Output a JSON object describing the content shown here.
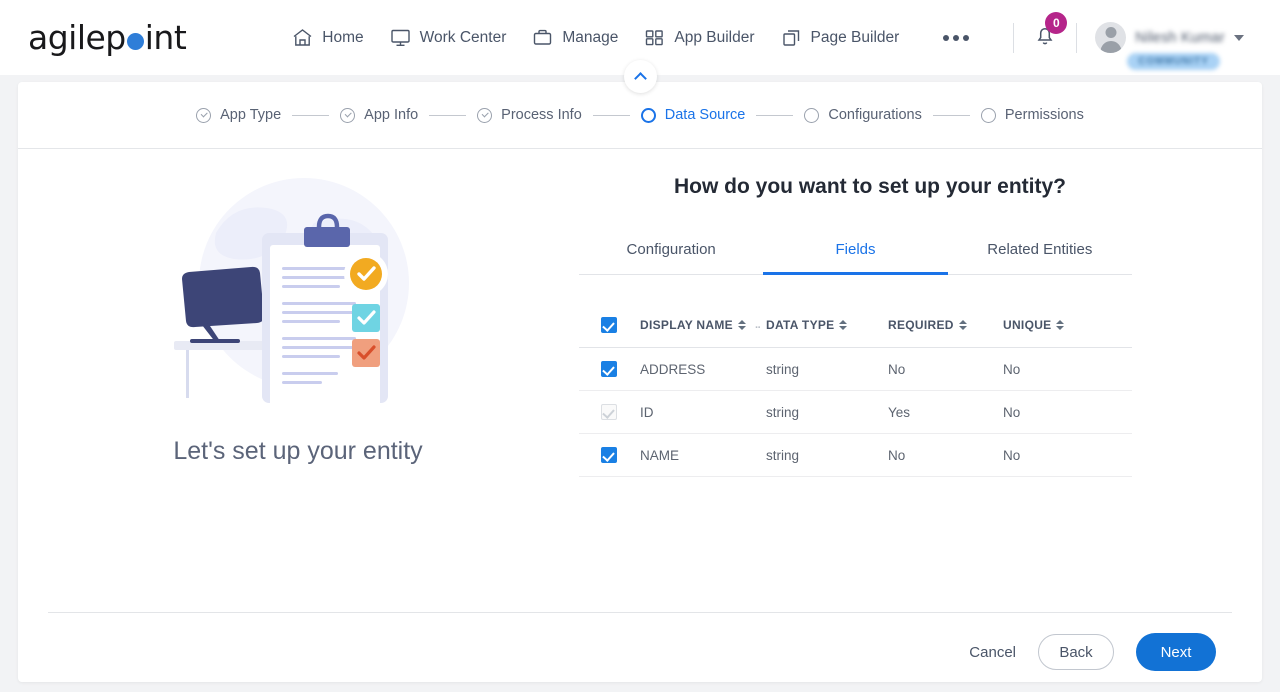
{
  "brand": {
    "name_part1": "agilep",
    "name_part2": "int",
    "dot_icon": "blue-dot",
    "accent": "#2f7ed8"
  },
  "topnav": {
    "items": [
      {
        "label": "Home",
        "icon": "home-icon"
      },
      {
        "label": "Work Center",
        "icon": "monitor-icon"
      },
      {
        "label": "Manage",
        "icon": "briefcase-icon"
      },
      {
        "label": "App Builder",
        "icon": "grid-icon"
      },
      {
        "label": "Page Builder",
        "icon": "pages-icon"
      }
    ],
    "more_icon": "ellipsis-icon",
    "notifications": {
      "icon": "bell-icon",
      "count": "0",
      "badge_color": "#b5258a"
    },
    "user": {
      "avatar_icon": "user-avatar-icon",
      "name": "Nilesh Kumar",
      "badge": "COMMUNITY",
      "chevron_icon": "chevron-down-icon"
    }
  },
  "collapse": {
    "icon": "chevron-up-icon"
  },
  "stepper": {
    "steps": [
      {
        "label": "App Type",
        "state": "done"
      },
      {
        "label": "App Info",
        "state": "done"
      },
      {
        "label": "Process Info",
        "state": "done"
      },
      {
        "label": "Data Source",
        "state": "active"
      },
      {
        "label": "Configurations",
        "state": "pending"
      },
      {
        "label": "Permissions",
        "state": "pending"
      }
    ],
    "active_color": "#1a73e8"
  },
  "illustration": {
    "name": "clipboard-checklist-illustration",
    "caption": "Let's set up your entity"
  },
  "main": {
    "title": "How do you want to set up your entity?",
    "tabs": [
      {
        "label": "Configuration",
        "active": false
      },
      {
        "label": "Fields",
        "active": true
      },
      {
        "label": "Related Entities",
        "active": false
      }
    ]
  },
  "table": {
    "select_all_checked": true,
    "columns": [
      {
        "label": "DISPLAY NAME",
        "sortable": true
      },
      {
        "label": "DATA TYPE",
        "sortable": true
      },
      {
        "label": "REQUIRED",
        "sortable": true
      },
      {
        "label": "UNIQUE",
        "sortable": true
      }
    ],
    "rows": [
      {
        "checked": true,
        "disabled": false,
        "display_name": "ADDRESS",
        "data_type": "string",
        "required": "No",
        "unique": "No"
      },
      {
        "checked": true,
        "disabled": true,
        "display_name": "ID",
        "data_type": "string",
        "required": "Yes",
        "unique": "No"
      },
      {
        "checked": true,
        "disabled": false,
        "display_name": "NAME",
        "data_type": "string",
        "required": "No",
        "unique": "No"
      }
    ]
  },
  "footer": {
    "cancel_label": "Cancel",
    "back_label": "Back",
    "next_label": "Next",
    "next_color": "#1272d5"
  }
}
